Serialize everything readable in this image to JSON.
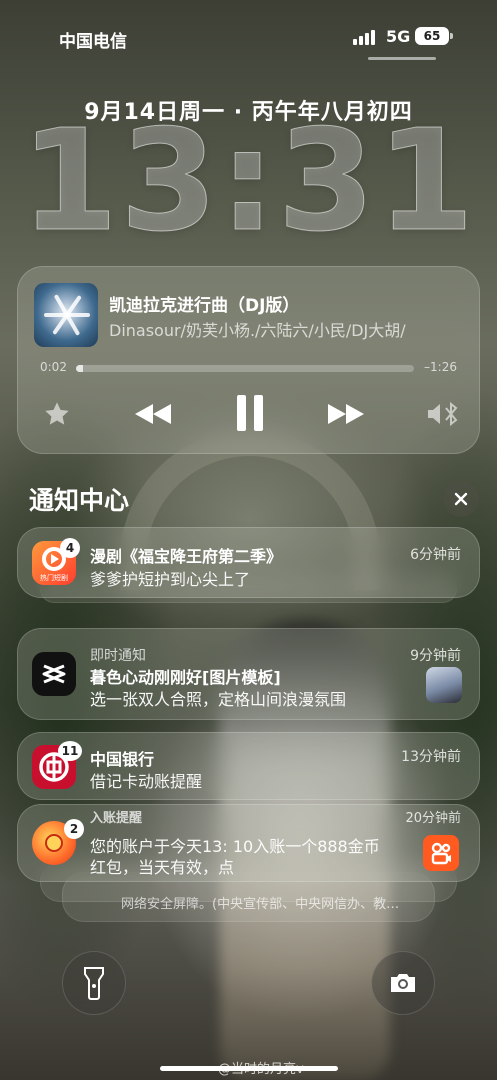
{
  "status_bar": {
    "carrier": "中国电信",
    "network": "5G",
    "battery": "65"
  },
  "lockscreen": {
    "date": "9月14日周一 · 丙午年八月初四",
    "time": "13:31"
  },
  "now_playing": {
    "title": "凯迪拉克进行曲（DJ版）",
    "artist": "Dinasour/奶芙小杨./六陆六/小民/DJ大胡/",
    "elapsed": "0:02",
    "remaining": "–1:26",
    "progress": 0.02,
    "icons": [
      "star-icon",
      "rewind-icon",
      "pause-icon",
      "fast-forward-icon",
      "speaker-bluetooth-icon"
    ]
  },
  "notification_center": {
    "title": "通知中心"
  },
  "notifications": [
    {
      "app_icon": "hongguo-short-drama-icon",
      "badge": "4",
      "title": "漫剧《福宝降王府第二季》",
      "body": "爹爹护短护到心尖上了",
      "time": "6分钟前",
      "icon_label": "热门短剧",
      "accent": "#ff6a2b"
    },
    {
      "app_icon": "capcut-icon",
      "category": "即时通知",
      "title": "暮色心动刚刚好[图片模板]",
      "body": "选一张双人合照，定格山间浪漫氛围",
      "time": "9分钟前",
      "accent": "#111111"
    },
    {
      "app_icon": "bank-of-china-icon",
      "badge": "11",
      "title": "中国银行",
      "body": "借记卡动账提醒",
      "time": "13分钟前",
      "accent": "#c8102e"
    },
    {
      "app_icon": "kuaishou-icon",
      "badge": "2",
      "title": "入账提醒",
      "body_line1": "您的账户于今天13: 10入账一个888金币",
      "body_line2": "红包，当天有效，点",
      "time": "20分钟前",
      "accent": "#ff5a1f"
    }
  ],
  "stacked_preview": "网络安全屏障。(中央宣传部、中央网信办、教…",
  "bottom": {
    "left_icon": "flashlight-icon",
    "right_icon": "camera-icon"
  },
  "watermark": "@当时的月亮v"
}
